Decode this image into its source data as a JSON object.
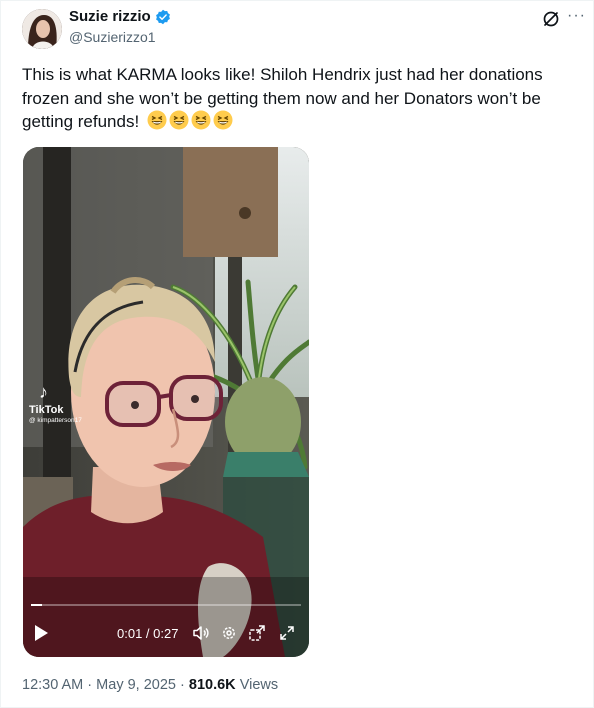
{
  "author": {
    "display_name": "Suzie rizzio",
    "handle": "@Suzierizzo1",
    "verified": true,
    "verified_color": "#1d9bf0"
  },
  "actions": {
    "grok_icon": "grok-icon",
    "more_icon": "more-icon",
    "more_label": "···"
  },
  "tweet": {
    "text": "This is what KARMA looks like! Shiloh Hendrix just had her donations frozen and she won’t be getting them now and her Donators won’t be getting refunds!",
    "emojis": [
      "grinning-squinting-face",
      "grinning-squinting-face",
      "grinning-squinting-face",
      "grinning-squinting-face"
    ]
  },
  "video": {
    "watermark_brand": "TikTok",
    "watermark_user": "@ kimpatterson17",
    "time_display": "0:01 / 0:27",
    "progress": 0.04,
    "controls": [
      "play-icon",
      "volume-icon",
      "settings-icon",
      "popout-icon",
      "fullscreen-icon"
    ]
  },
  "meta": {
    "time": "12:30 AM",
    "date": "May 9, 2025",
    "views_count": "810.6K",
    "views_label": "Views",
    "separator": "·"
  },
  "colors": {
    "text_primary": "#0f1419",
    "text_secondary": "#536471",
    "accent": "#1d9bf0"
  }
}
